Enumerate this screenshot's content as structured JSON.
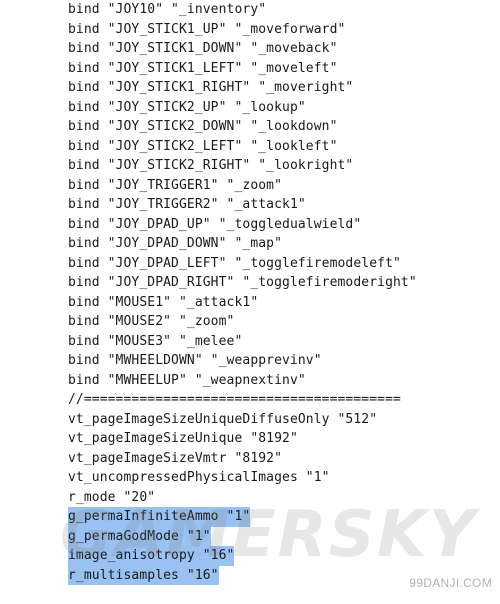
{
  "editor": {
    "lines": [
      {
        "text": "bind \"JOY10\" \"_inventory\"",
        "selected": false
      },
      {
        "text": "bind \"JOY_STICK1_UP\" \"_moveforward\"",
        "selected": false
      },
      {
        "text": "bind \"JOY_STICK1_DOWN\" \"_moveback\"",
        "selected": false
      },
      {
        "text": "bind \"JOY_STICK1_LEFT\" \"_moveleft\"",
        "selected": false
      },
      {
        "text": "bind \"JOY_STICK1_RIGHT\" \"_moveright\"",
        "selected": false
      },
      {
        "text": "bind \"JOY_STICK2_UP\" \"_lookup\"",
        "selected": false
      },
      {
        "text": "bind \"JOY_STICK2_DOWN\" \"_lookdown\"",
        "selected": false
      },
      {
        "text": "bind \"JOY_STICK2_LEFT\" \"_lookleft\"",
        "selected": false
      },
      {
        "text": "bind \"JOY_STICK2_RIGHT\" \"_lookright\"",
        "selected": false
      },
      {
        "text": "bind \"JOY_TRIGGER1\" \"_zoom\"",
        "selected": false
      },
      {
        "text": "bind \"JOY_TRIGGER2\" \"_attack1\"",
        "selected": false
      },
      {
        "text": "bind \"JOY_DPAD_UP\" \"_toggledualwield\"",
        "selected": false
      },
      {
        "text": "bind \"JOY_DPAD_DOWN\" \"_map\"",
        "selected": false
      },
      {
        "text": "bind \"JOY_DPAD_LEFT\" \"_togglefiremodeleft\"",
        "selected": false
      },
      {
        "text": "bind \"JOY_DPAD_RIGHT\" \"_togglefiremoderight\"",
        "selected": false
      },
      {
        "text": "bind \"MOUSE1\" \"_attack1\"",
        "selected": false
      },
      {
        "text": "bind \"MOUSE2\" \"_zoom\"",
        "selected": false
      },
      {
        "text": "bind \"MOUSE3\" \"_melee\"",
        "selected": false
      },
      {
        "text": "bind \"MWHEELDOWN\" \"_weapprevinv\"",
        "selected": false
      },
      {
        "text": "bind \"MWHEELUP\" \"_weapnextinv\"",
        "selected": false
      },
      {
        "text": "//========================================",
        "selected": false
      },
      {
        "text": "vt_pageImageSizeUniqueDiffuseOnly \"512\"",
        "selected": false
      },
      {
        "text": "vt_pageImageSizeUnique \"8192\"",
        "selected": false
      },
      {
        "text": "vt_pageImageSizeVmtr \"8192\"",
        "selected": false
      },
      {
        "text": "vt_uncompressedPhysicalImages \"1\"",
        "selected": false
      },
      {
        "text": "r_mode \"20\"",
        "selected": false
      },
      {
        "text": "g_permaInfiniteAmmo \"1\"",
        "selected": true
      },
      {
        "text": "g_permaGodMode \"1\"",
        "selected": true
      },
      {
        "text": "image_anisotropy \"16\"",
        "selected": true
      },
      {
        "text": "r_multisamples \"16\"",
        "selected": true
      }
    ],
    "selection_color": "#99c1f1"
  },
  "watermark": {
    "text": "GAMERSKY"
  },
  "site_tag": {
    "text": "99DANJI.COM"
  }
}
